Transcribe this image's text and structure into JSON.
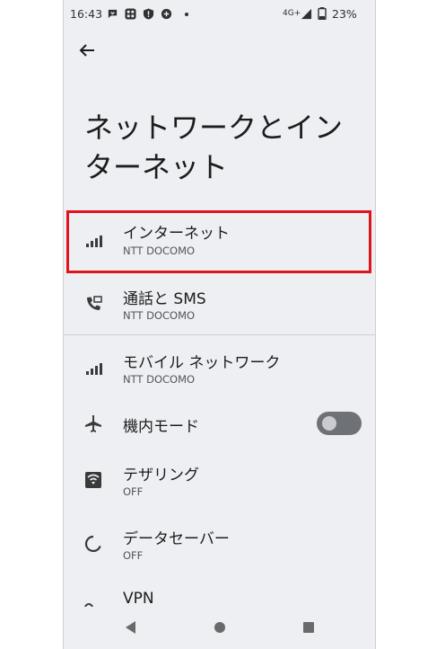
{
  "status_bar": {
    "time": "16:43",
    "network": "4G+",
    "battery": "23%",
    "icons": [
      "chat-icon",
      "app-icon",
      "shield-icon",
      "data-saver-icon"
    ]
  },
  "page": {
    "title_line1": "ネットワークとイン",
    "title_line2": "ターネット"
  },
  "items": [
    {
      "title": "インターネット",
      "subtitle": "NTT DOCOMO",
      "icon": "signal-icon"
    },
    {
      "title": "通話と SMS",
      "subtitle": "NTT DOCOMO",
      "icon": "call-sms-icon"
    },
    {
      "title": "モバイル ネットワーク",
      "subtitle": "NTT DOCOMO",
      "icon": "signal-icon"
    },
    {
      "title": "機内モード",
      "icon": "airplane-icon",
      "toggle": "off"
    },
    {
      "title": "テザリング",
      "subtitle": "OFF",
      "icon": "hotspot-icon"
    },
    {
      "title": "データセーバー",
      "subtitle": "OFF",
      "icon": "data-saver-icon"
    },
    {
      "title": "VPN",
      "icon": "vpn-key-icon"
    }
  ],
  "colors": {
    "highlight": "#e0141b",
    "background": "#eeeff3"
  }
}
